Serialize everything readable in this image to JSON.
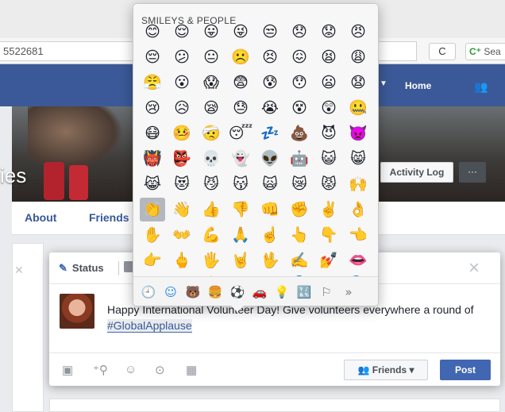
{
  "browser": {
    "url_fragment": "5522681",
    "reload_label": "C",
    "search_label": "Sea"
  },
  "fb_header": {
    "home_label": "Home"
  },
  "cover": {
    "name_fragment": "ies",
    "activity_log_label": "Activity Log",
    "more_label": "···"
  },
  "tabs": [
    {
      "label": "About"
    },
    {
      "label": "Friends"
    }
  ],
  "composer": {
    "status_label": "Status",
    "close_label": "×",
    "post_text_before": "Happy International Volun",
    "post_text_gap": "teer Day! Give volunteers everywhere a round of ",
    "hashtag": "#GlobalApplause",
    "friends_label": "Friends ▾",
    "friends_icon": "👥",
    "post_label": "Post"
  },
  "emoji_picker": {
    "title": "SMILEYS & PEOPLE",
    "rows": [
      [
        "😊",
        "😌",
        "😛",
        "😜",
        "😒",
        "😞",
        "😟",
        "😠"
      ],
      [
        "😔",
        "😕",
        "😐",
        "☹️",
        "😣",
        "😖",
        "😫",
        "😩"
      ],
      [
        "😤",
        "😮",
        "😱",
        "😨",
        "😰",
        "😯",
        "😦",
        "😧"
      ],
      [
        "😢",
        "😥",
        "😪",
        "😓",
        "😭",
        "😵",
        "😲",
        "🤐"
      ],
      [
        "😷",
        "🤒",
        "🤕",
        "😴",
        "💤",
        "💩",
        "😈",
        "👿"
      ],
      [
        "👹",
        "👺",
        "💀",
        "👻",
        "👽",
        "🤖",
        "😺",
        "😸"
      ],
      [
        "😹",
        "😻",
        "😼",
        "😽",
        "🙀",
        "😿",
        "😾",
        "🙌"
      ],
      [
        "👏",
        "👋",
        "👍",
        "👎",
        "👊",
        "✊",
        "✌️",
        "👌"
      ],
      [
        "✋",
        "👐",
        "💪",
        "🙏",
        "☝️",
        "👆",
        "👇",
        "👈"
      ],
      [
        "👉",
        "🖕",
        "🖐️",
        "🤘",
        "🖖",
        "✍️",
        "💅",
        "👄"
      ],
      [
        "👅",
        "👂",
        "👃",
        "👁️",
        "👀",
        "👤",
        "👥",
        "🗣️"
      ]
    ],
    "selected_row": 7,
    "selected_col": 0,
    "categories": [
      {
        "icon": "🕘",
        "name": "recent-icon"
      },
      {
        "icon": "☺",
        "name": "smileys-icon"
      },
      {
        "icon": "🐻",
        "name": "animals-icon"
      },
      {
        "icon": "🍔",
        "name": "food-icon"
      },
      {
        "icon": "⚽",
        "name": "sports-icon"
      },
      {
        "icon": "🚗",
        "name": "travel-icon"
      },
      {
        "icon": "💡",
        "name": "objects-icon"
      },
      {
        "icon": "🔣",
        "name": "symbols-icon"
      },
      {
        "icon": "⚐",
        "name": "flags-icon"
      },
      {
        "icon": "»",
        "name": "more-categories-icon"
      }
    ],
    "active_category": 1
  },
  "foot_icons": [
    {
      "icon": "📷",
      "name": "photo-icon"
    },
    {
      "icon": "👤",
      "name": "tag-friends-icon"
    },
    {
      "icon": "☺",
      "name": "feeling-icon"
    },
    {
      "icon": "📍",
      "name": "location-icon"
    },
    {
      "icon": "📅",
      "name": "event-icon"
    }
  ]
}
